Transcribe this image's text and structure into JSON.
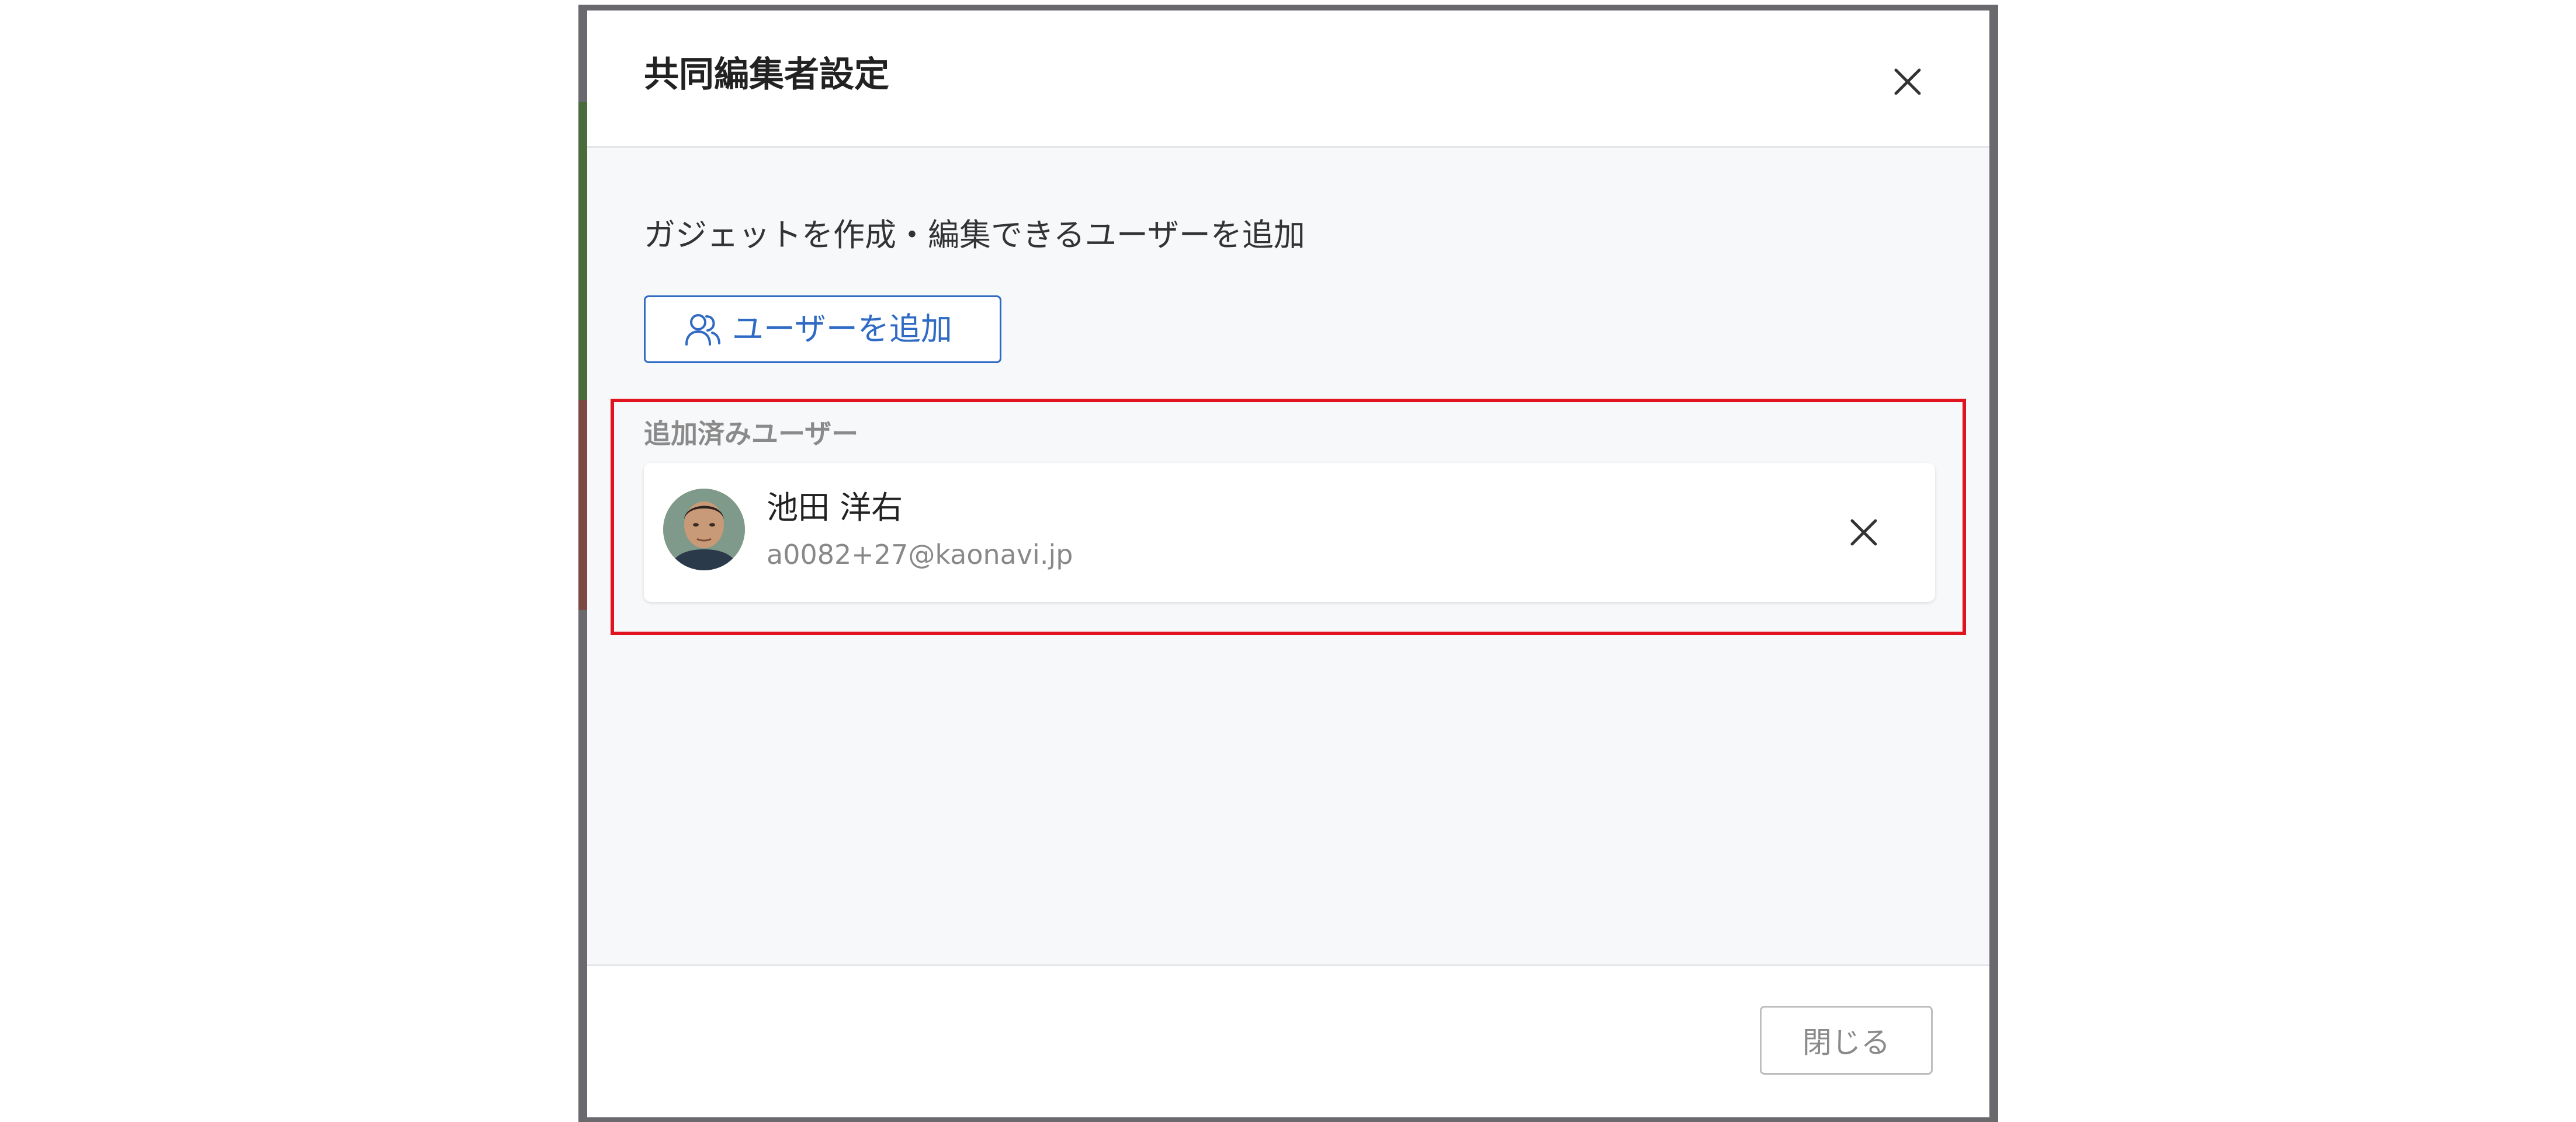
{
  "dialog": {
    "title": "共同編集者設定",
    "description": "ガジェットを作成・編集できるユーザーを追加",
    "add_user_label": "ユーザーを追加",
    "added_users_label": "追加済みユーザー",
    "close_label": "閉じる"
  },
  "added_users": [
    {
      "name": "池田 洋右",
      "email": "a0082+27@kaonavi.jp"
    }
  ],
  "colors": {
    "accent": "#2f6bc4",
    "highlight": "#e0141e",
    "body_background": "#f7f8fa"
  },
  "icons": {
    "close": "close-icon",
    "add_user": "users-icon",
    "remove": "remove-icon"
  }
}
